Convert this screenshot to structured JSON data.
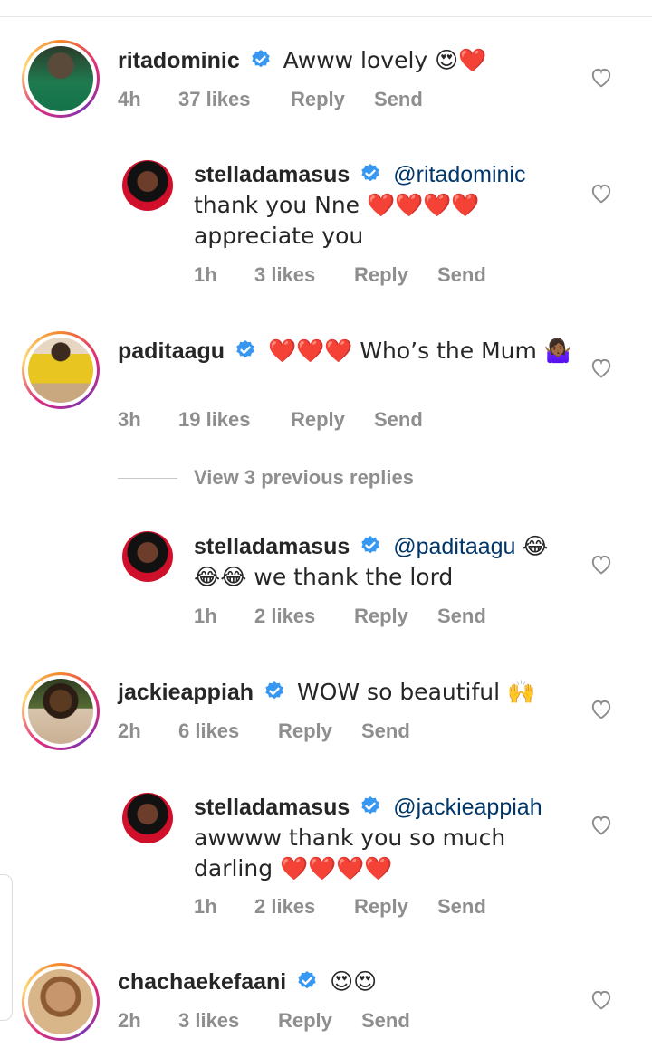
{
  "comments": [
    {
      "username": "ritadominic",
      "text": "Awww lovely 😍❤️",
      "time": "4h",
      "likes": "37 likes",
      "reply": "Reply",
      "send": "Send"
    },
    {
      "username": "stelladamasus",
      "mention": "@ritadominic",
      "text": "thank you Nne ❤️❤️❤️❤️ appreciate you",
      "time": "1h",
      "likes": "3 likes",
      "reply": "Reply",
      "send": "Send"
    },
    {
      "username": "paditaagu",
      "text": "❤️❤️❤️ Who’s the Mum 🤷🏾‍♀️",
      "time": "3h",
      "likes": "19 likes",
      "reply": "Reply",
      "send": "Send"
    },
    {
      "username": "stelladamasus",
      "mention": "@paditaagu",
      "text": "😂😂😂 we thank the lord",
      "time": "1h",
      "likes": "2 likes",
      "reply": "Reply",
      "send": "Send"
    },
    {
      "username": "jackieappiah",
      "text": "WOW so beautiful 🙌",
      "time": "2h",
      "likes": "6 likes",
      "reply": "Reply",
      "send": "Send"
    },
    {
      "username": "stelladamasus",
      "mention": "@jackieappiah",
      "text": "awwww thank you so much darling ❤️❤️❤️❤️",
      "time": "1h",
      "likes": "2 likes",
      "reply": "Reply",
      "send": "Send"
    },
    {
      "username": "chachaekefaani",
      "text": "😍😍",
      "time": "2h",
      "likes": "3 likes",
      "reply": "Reply",
      "send": "Send"
    }
  ],
  "view_replies": "View 3 previous replies",
  "icons": {
    "verified": "verified-badge-icon",
    "like": "heart-outline-icon"
  },
  "colors": {
    "verified": "#3897f0",
    "mention": "#00376b",
    "meta": "#8e8e8e"
  }
}
